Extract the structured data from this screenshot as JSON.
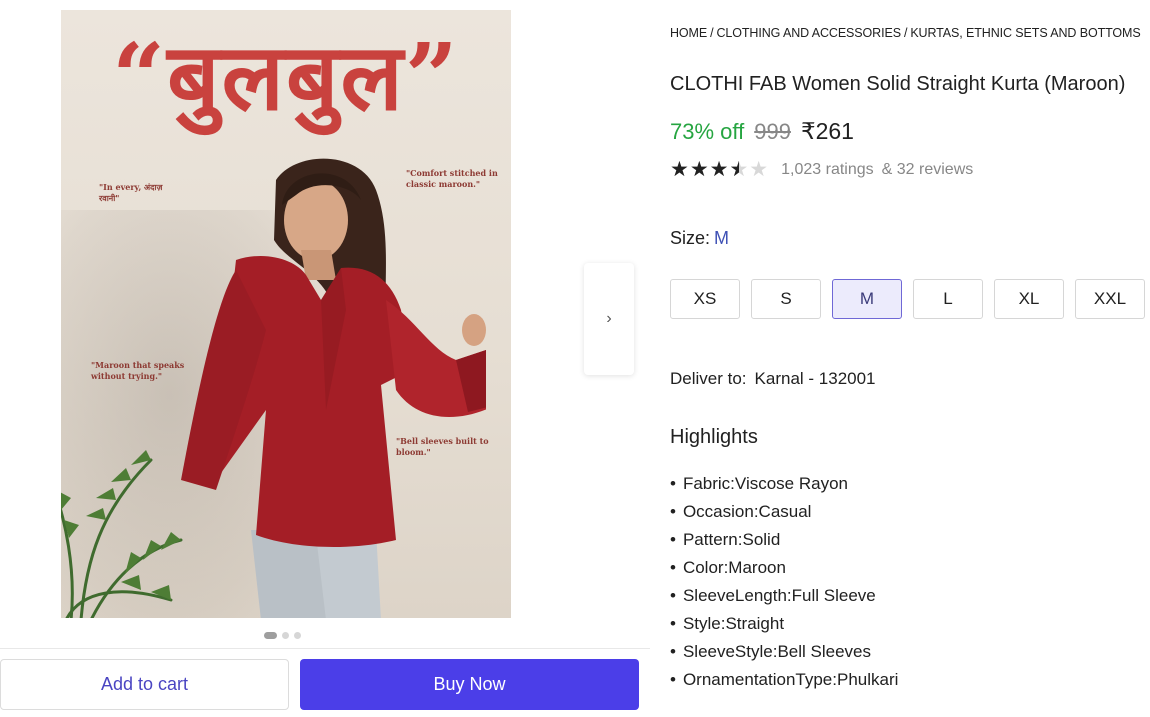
{
  "gallery": {
    "poster_title": "“बुलबुल”",
    "poster_notes": [
      "\"In every, अंदाज़ रवानी\"",
      "\"Comfort stitched in classic maroon.\"",
      "\"Maroon that speaks without trying.\"",
      "\"Bell sleeves built to bloom.\""
    ],
    "next_icon": "›",
    "dots": [
      true,
      false,
      false
    ]
  },
  "actions": {
    "add_to_cart": "Add to cart",
    "buy_now": "Buy Now"
  },
  "breadcrumb": [
    "HOME",
    "CLOTHING AND ACCESSORIES",
    "KURTAS, ETHNIC SETS AND BOTTOMS"
  ],
  "product": {
    "title": "CLOTHI FAB Women Solid Straight Kurta (Maroon)",
    "discount": "73% off",
    "mrp": "999",
    "price": "₹261",
    "rating_value": 3.5,
    "ratings": "1,023 ratings",
    "reviews": "& 32 reviews"
  },
  "size": {
    "label": "Size:",
    "selected": "M",
    "options": [
      "XS",
      "S",
      "M",
      "L",
      "XL",
      "XXL"
    ]
  },
  "delivery": {
    "label": "Deliver to:",
    "location": "Karnal - 132001"
  },
  "highlights": {
    "title": "Highlights",
    "items": [
      "Fabric:Viscose Rayon",
      "Occasion:Casual",
      "Pattern:Solid",
      "Color:Maroon",
      "SleeveLength:Full Sleeve",
      "Style:Straight",
      "SleeveStyle:Bell Sleeves",
      "OrnamentationType:Phulkari"
    ]
  },
  "colors": {
    "accent": "#4b3ee8",
    "discount": "#26a541",
    "selected_size_bg": "#ecebfc",
    "poster_red": "#c9423e"
  }
}
